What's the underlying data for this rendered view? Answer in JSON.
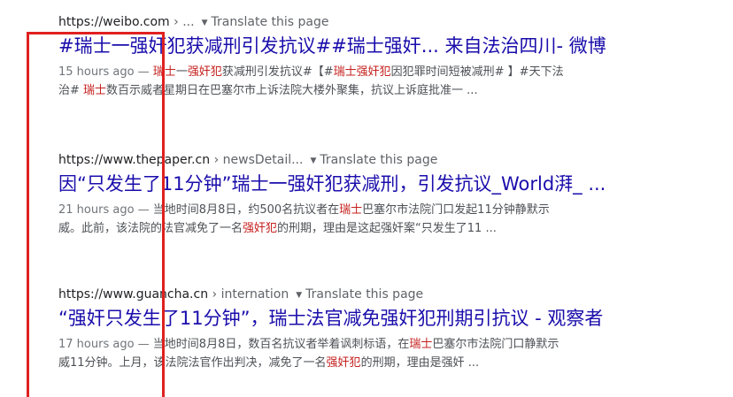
{
  "results": [
    {
      "url": "https://weibo.com",
      "crumbs": " › ...",
      "translate_arrow": "▼",
      "translate_label": "Translate this page",
      "title": "#瑞士一强奸犯获减刑引发抗议##瑞士强奸... 来自法治四川- 微博",
      "snippet": {
        "time": "15 hours ago — ",
        "line1_parts": [
          "瑞士",
          "一",
          "强奸犯",
          "获减刑引发抗议#【#",
          "瑞士强奸犯",
          "因犯罪时间短被减刑# 】#天下法"
        ],
        "line2_parts": [
          "治# ",
          "瑞士",
          "数百示威者星期日在巴塞尔市上诉法院大楼外聚集，抗议上诉庭批准一 ..."
        ]
      }
    },
    {
      "url": "https://www.thepaper.cn",
      "crumbs": " › newsDetail...",
      "translate_arrow": "▼",
      "translate_label": "Translate this page",
      "title": "因“只发生了11分钟”瑞士一强奸犯获减刑，引发抗议_World湃_ ...",
      "snippet": {
        "time": "21 hours ago — ",
        "line1_parts": [
          "当地时间8月8日，约500名抗议者在",
          "瑞士",
          "巴塞尔市法院门口发起11分钟静默示"
        ],
        "line2_parts": [
          "威。此前，该法院的法官减免了一名",
          "强奸犯",
          "的刑期，理由是这起强奸案“只发生了11 ..."
        ]
      }
    },
    {
      "url": "https://www.guancha.cn",
      "crumbs": " › internation",
      "translate_arrow": "▼",
      "translate_label": "Translate this page",
      "title": "“强奸只发生了11分钟”，瑞士法官减免强奸犯刑期引抗议 - 观察者",
      "snippet": {
        "time": "17 hours ago — ",
        "line1_parts": [
          "当地时间8月8日，数百名抗议者举着讽刺标语，在",
          "瑞士",
          "巴塞尔市法院门口静默示"
        ],
        "line2_parts": [
          "威11分钟。上月，该法院法官作出判决，减免了一名",
          "强奸犯",
          "的刑期，理由是强奸 ..."
        ]
      }
    }
  ],
  "colors": {
    "link": "#1a0dab",
    "highlight": "#c5221f",
    "annotation_box": "#e02020"
  }
}
